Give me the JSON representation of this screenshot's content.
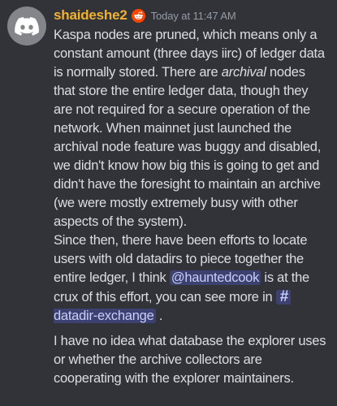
{
  "author": {
    "name": "shaideshe2",
    "badge_icon": "reddit-alien-icon",
    "badge_color": "#ff4500",
    "name_color": "#f0b232",
    "avatar_icon": "discord-logo-icon",
    "avatar_bg": "#83858b"
  },
  "timestamp": "Today at 11:47 AM",
  "message": {
    "p1_a": "Kaspa nodes are pruned, which means only a constant amount (three days iirc) of ledger data is normally stored. There are ",
    "p1_em": "archival",
    "p1_b": " nodes that store the entire ledger data, though they are not required for a secure operation of the network. When mainnet just launched the archival node feature was buggy and disabled, we didn't know how big this is going to get and didn't have the foresight to maintain an archive (we were mostly extremely busy with other aspects of the system).",
    "p2_a": "Since then, there have been efforts to locate users with old datadirs to piece together the entire ledger, I think ",
    "mention": "@hauntedcook",
    "p2_b": " is at the crux of this effort, you can see more in ",
    "channel_hash": "#",
    "channel_name": "datadir-exchange",
    "p2_c": " .",
    "p3": "I have no idea what database the explorer uses or whether the archive collectors are cooperating with the explorer maintainers."
  }
}
